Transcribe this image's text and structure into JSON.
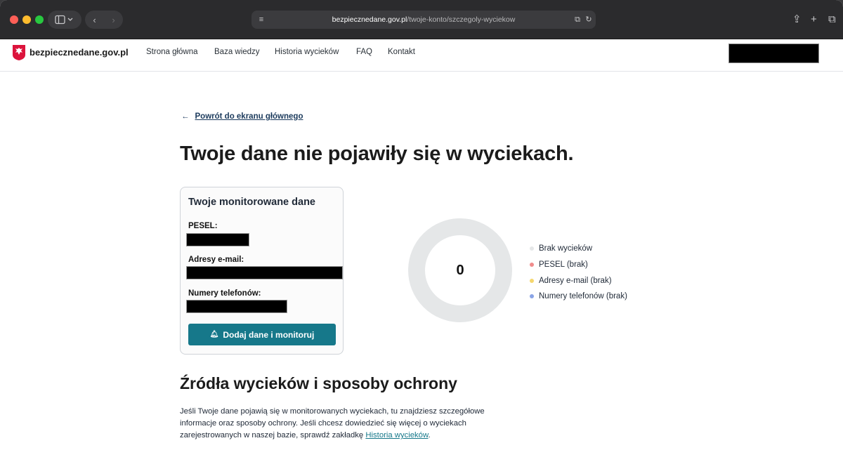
{
  "browser": {
    "url_domain": "bezpiecznedane.gov.pl",
    "url_path": "/twoje-konto/szczegoly-wyciekow"
  },
  "header": {
    "brand": "bezpiecznedane.gov.pl",
    "nav": [
      "Strona główna",
      "Baza wiedzy",
      "Historia wycieków",
      "FAQ",
      "Kontakt"
    ]
  },
  "main": {
    "back_link": "Powrót do ekranu głównego",
    "title": "Twoje dane nie pojawiły się w wyciekach."
  },
  "card": {
    "title": "Twoje monitorowane dane",
    "pesel_label": "PESEL:",
    "email_label": "Adresy e-mail:",
    "phone_label": "Numery telefonów:",
    "cta_label": "Dodaj dane i monitoruj"
  },
  "chart_data": {
    "type": "pie",
    "center_value": "0",
    "series": [
      {
        "name": "Brak wycieków",
        "value": 0,
        "color": "#e5e7e8"
      },
      {
        "name": "PESEL (brak)",
        "value": 0,
        "color": "#f08c8c"
      },
      {
        "name": "Adresy e-mail (brak)",
        "value": 0,
        "color": "#f5d76e"
      },
      {
        "name": "Numery telefonów (brak)",
        "value": 0,
        "color": "#8aa4e6"
      }
    ]
  },
  "sources": {
    "title": "Źródła wycieków i sposoby ochrony",
    "text_before": "Jeśli Twoje dane pojawią się w monitorowanych wyciekach, tu znajdziesz szczegółowe informacje oraz sposoby ochrony. Jeśli chcesz dowiedzieć się więcej o wyciekach zarejestrowanych w naszej bazie, sprawdź zakładkę ",
    "link": "Historia wycieków",
    "text_after": "."
  }
}
